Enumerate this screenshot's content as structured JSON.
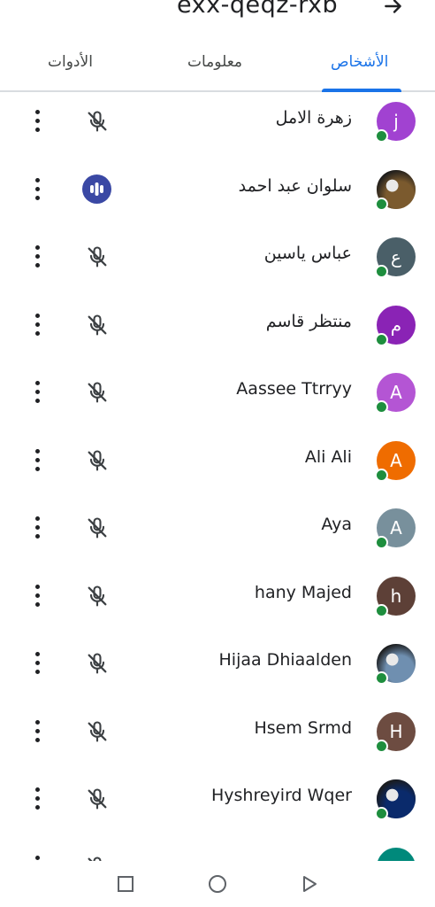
{
  "header": {
    "meeting_code": "exx-qeqz-rxb",
    "icon": "arrow-right-icon"
  },
  "tabs": [
    {
      "label": "الأشخاص",
      "active": true
    },
    {
      "label": "معلومات",
      "active": false
    },
    {
      "label": "الأدوات",
      "active": false
    }
  ],
  "participants": [
    {
      "name": "زهرة الامل",
      "avatar_letter": "j",
      "avatar_color": "#a142d1",
      "audio": "muted"
    },
    {
      "name": "سلوان عبد احمد",
      "avatar_letter": "",
      "avatar_color": "#7b5a2e",
      "avatar_photo": true,
      "audio": "speaking"
    },
    {
      "name": "عباس ياسين",
      "avatar_letter": "ع",
      "avatar_color": "#4a5f68",
      "audio": "muted"
    },
    {
      "name": "منتظر قاسم",
      "avatar_letter": "م",
      "avatar_color": "#8a23b5",
      "audio": "muted"
    },
    {
      "name": "Aassee Ttrryy",
      "avatar_letter": "A",
      "avatar_color": "#b455d4",
      "audio": "muted"
    },
    {
      "name": "Ali Ali",
      "avatar_letter": "A",
      "avatar_color": "#ef6c00",
      "audio": "muted"
    },
    {
      "name": "Aya",
      "avatar_letter": "A",
      "avatar_color": "#78909c",
      "audio": "muted"
    },
    {
      "name": "hany Majed",
      "avatar_letter": "h",
      "avatar_color": "#5d4037",
      "audio": "muted"
    },
    {
      "name": "Hijaa Dhiaalden",
      "avatar_letter": "",
      "avatar_color": "#6f8fb0",
      "avatar_photo": true,
      "audio": "muted"
    },
    {
      "name": "Hsem Srmd",
      "avatar_letter": "H",
      "avatar_color": "#6d4c41",
      "audio": "muted"
    },
    {
      "name": "Hyshreyird Wqer",
      "avatar_letter": "",
      "avatar_color": "#0a2a6b",
      "avatar_photo": true,
      "audio": "muted"
    },
    {
      "name": "",
      "avatar_letter": "",
      "avatar_color": "#00897b",
      "audio": "muted"
    }
  ],
  "navbar": {
    "icons": [
      "recents-square-icon",
      "home-circle-icon",
      "back-triangle-icon"
    ]
  }
}
